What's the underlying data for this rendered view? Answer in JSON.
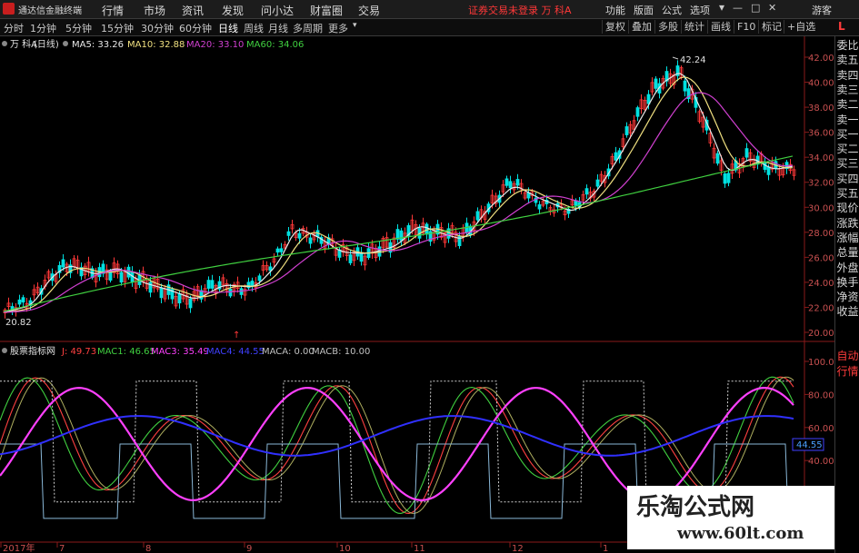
{
  "menubar": {
    "app_title": "通达信金融终端",
    "items": [
      "行情",
      "市场",
      "资讯",
      "发现",
      "问小达",
      "财富圈",
      "交易"
    ],
    "warning": "证券交易未登录  万 科A",
    "right_items": [
      "功能",
      "版面",
      "公式",
      "选项"
    ],
    "guest": "游客"
  },
  "toolbar": {
    "periods": [
      "分时",
      "1分钟",
      "5分钟",
      "15分钟",
      "30分钟",
      "60分钟",
      "日线",
      "周线",
      "月线",
      "多周期",
      "更多"
    ],
    "active_period": "日线",
    "right_buttons": [
      "复权",
      "叠加",
      "多股",
      "统计",
      "画线",
      "F10",
      "标记",
      "+自选"
    ],
    "corner_label": "L"
  },
  "main_chart": {
    "stock": "万 科A",
    "period_tag": "(日线)",
    "ma": [
      {
        "name": "MA5",
        "value": "33.26",
        "color": "#e8e8e8"
      },
      {
        "name": "MA10",
        "value": "32.88",
        "color": "#f0e080"
      },
      {
        "name": "MA20",
        "value": "33.10",
        "color": "#d040d0"
      },
      {
        "name": "MA60",
        "value": "34.06",
        "color": "#40d040"
      }
    ],
    "high_marker": "42.24",
    "low_marker": "20.82",
    "y_ticks": [
      "42.00",
      "40.00",
      "38.00",
      "36.00",
      "34.00",
      "32.00",
      "30.00",
      "28.00",
      "26.00",
      "24.00",
      "22.00",
      "20.00"
    ]
  },
  "indicator": {
    "name": "股票指标网",
    "items": [
      {
        "name": "J",
        "value": "49.73",
        "color": "#ff4040"
      },
      {
        "name": "MAC1",
        "value": "46.65",
        "color": "#40d040"
      },
      {
        "name": "MAC3",
        "value": "35.49",
        "color": "#ff40ff"
      },
      {
        "name": "MAC4",
        "value": "44.55",
        "color": "#4040ff"
      },
      {
        "name": "MACA",
        "value": "0.00",
        "color": "#c0c0c0"
      },
      {
        "name": "MACB",
        "value": "10.00",
        "color": "#c0c0c0"
      }
    ],
    "y_ticks": [
      "100.0",
      "80.00",
      "60.00",
      "40.00"
    ],
    "current_value": "44.55"
  },
  "x_axis": {
    "labels": [
      "2017年",
      "7",
      "8",
      "9",
      "10",
      "11",
      "12",
      "1"
    ]
  },
  "side_panel": {
    "items": [
      "委比",
      "卖五",
      "卖四",
      "卖三",
      "卖二",
      "卖一",
      "买一",
      "买二",
      "买三",
      "买四",
      "买五",
      "现价",
      "涨跌",
      "涨幅",
      "总量",
      "外盘",
      "换手",
      "净资",
      "收益",
      "自动",
      "行情"
    ]
  },
  "watermark": {
    "line1": "乐淘公式网",
    "line2": "www.60lt.com"
  },
  "colors": {
    "up": "#ff3838",
    "down": "#00e0e0",
    "ma5": "#e8e8e8",
    "ma10": "#f0e080",
    "ma20": "#d040d0",
    "ma60": "#40d040"
  }
}
